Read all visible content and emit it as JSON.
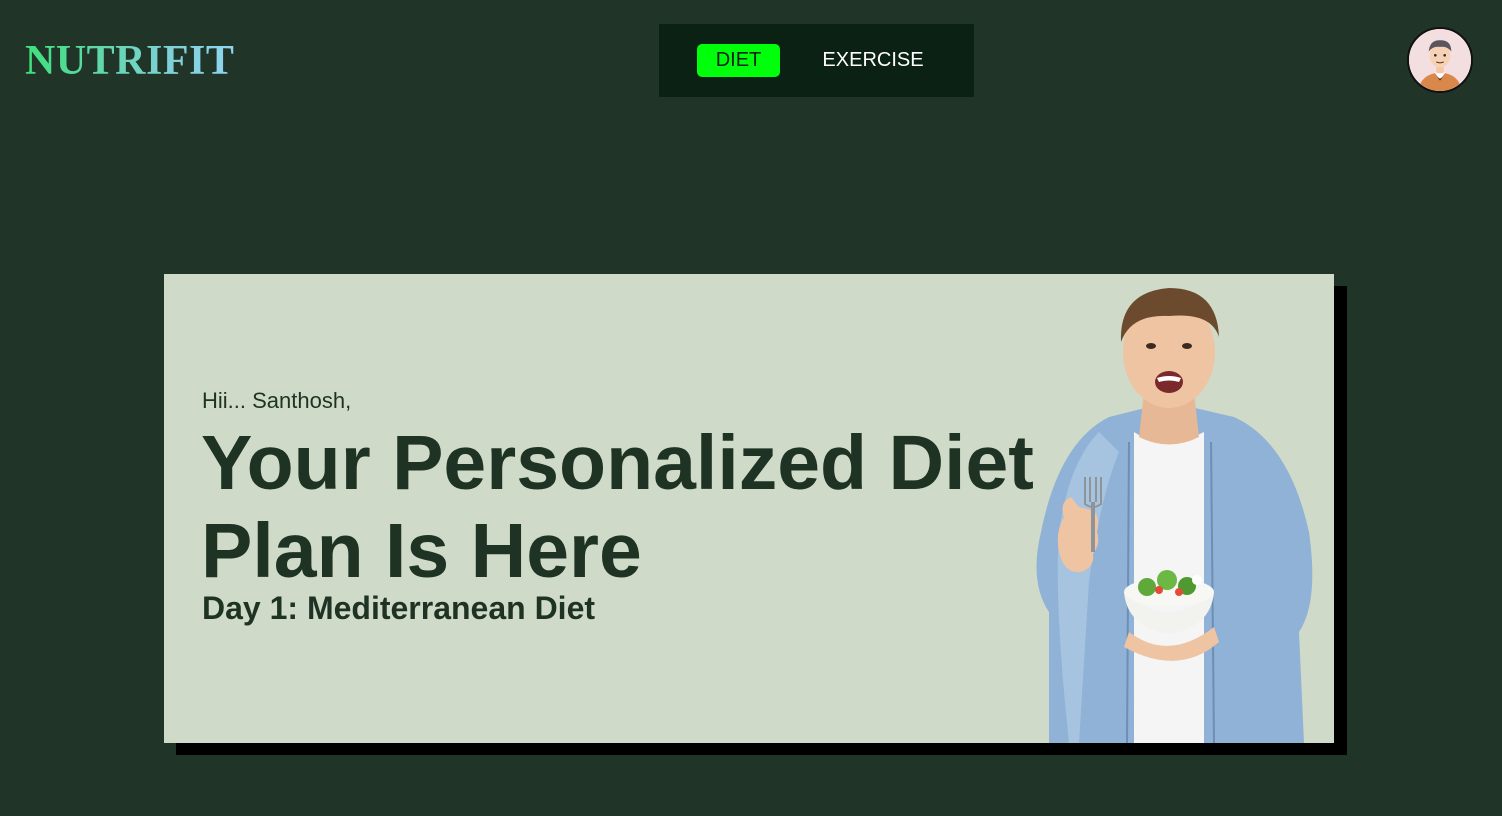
{
  "header": {
    "logo_text": "NUTRIFIT",
    "nav": {
      "items": [
        {
          "label": "DIET",
          "active": true
        },
        {
          "label": "EXERCISE",
          "active": false
        }
      ]
    },
    "avatar": "user-avatar"
  },
  "hero": {
    "greeting": "Hii... Santhosh,",
    "headline": "Your Personalized Diet Plan Is Here",
    "subheading": "Day 1: Mediterranean Diet",
    "image": "man-holding-salad-thumbs-up"
  },
  "colors": {
    "background": "#203428",
    "nav_background": "#0a2113",
    "active_tab": "#00ff0a",
    "card_background": "#cfdbc8",
    "text_dark": "#1e3323"
  }
}
